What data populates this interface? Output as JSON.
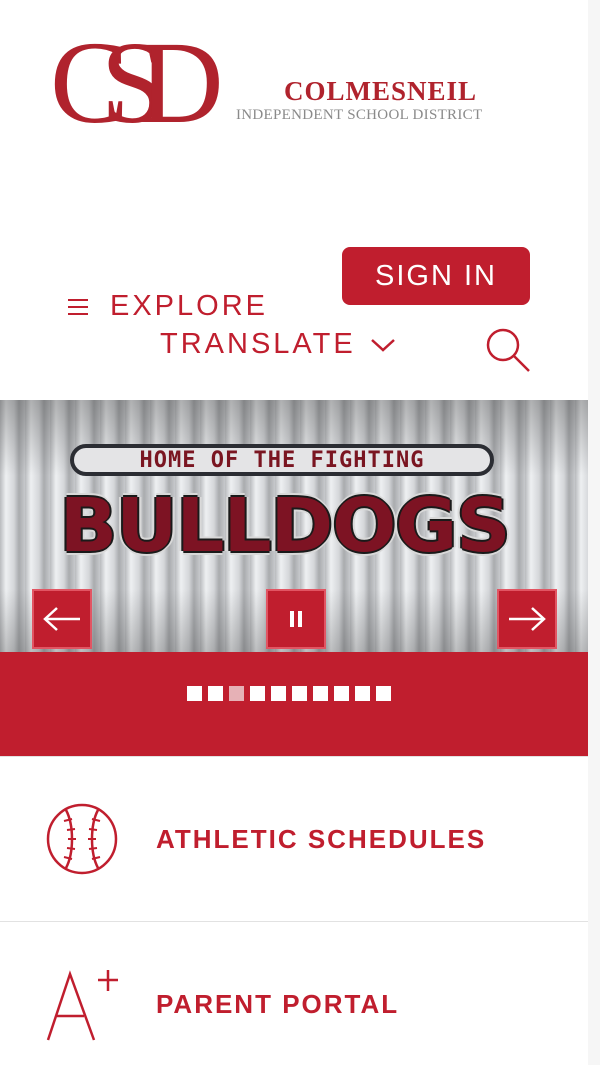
{
  "logo": {
    "monogram": "CSD",
    "name": "COLMESNEIL",
    "subtitle": "INDEPENDENT SCHOOL DISTRICT"
  },
  "header": {
    "sign_in_label": "SIGN IN",
    "explore_label": "EXPLORE",
    "translate_label": "TRANSLATE"
  },
  "hero": {
    "sign_top_text": "HOME OF THE FIGHTING",
    "sign_main_text": "BULLDOGS",
    "slide_count": 10,
    "active_slide": 3
  },
  "quick_links": [
    {
      "label": "ATHLETIC SCHEDULES",
      "icon": "baseball-icon"
    },
    {
      "label": "PARENT PORTAL",
      "icon": "a-plus-icon"
    }
  ],
  "colors": {
    "brand_red": "#c01e2e",
    "logo_red": "#b0232d",
    "logo_gray": "#8a8a8a",
    "white": "#ffffff"
  }
}
